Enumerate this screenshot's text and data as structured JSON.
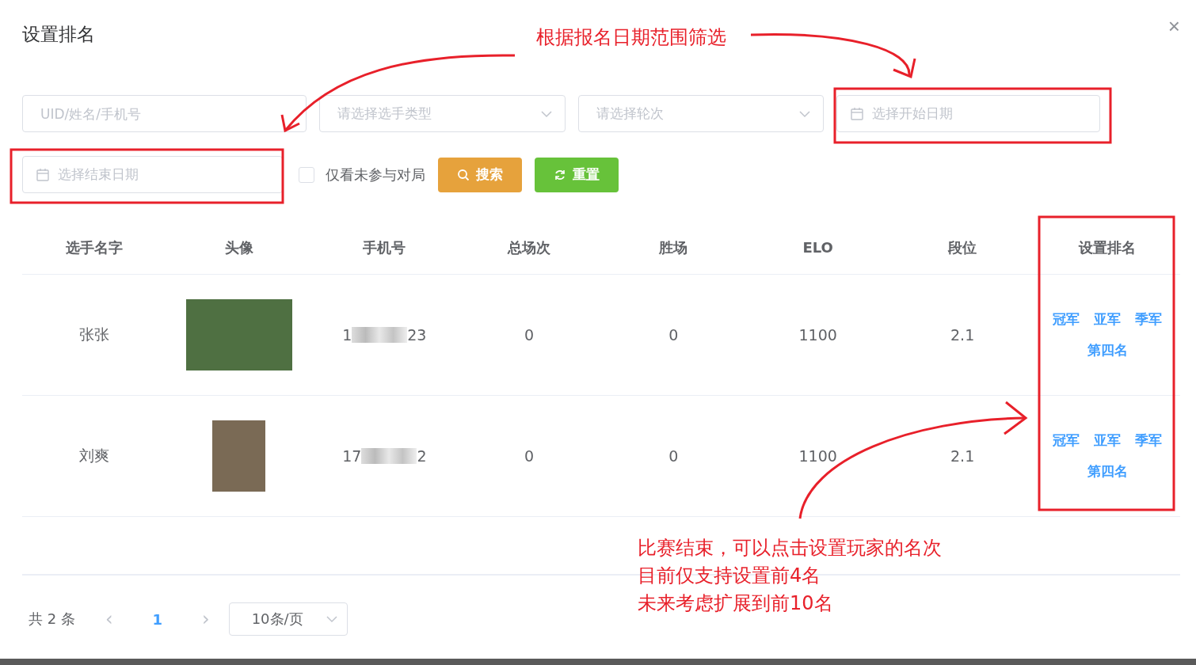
{
  "dialog": {
    "title": "设置排名",
    "close": "×"
  },
  "filters": [
    {
      "kind": "input",
      "placeholder": "UID/姓名/手机号"
    },
    {
      "kind": "select",
      "placeholder": "请选择选手类型"
    },
    {
      "kind": "select",
      "placeholder": "请选择轮次"
    },
    {
      "kind": "date",
      "placeholder": "选择开始日期"
    },
    {
      "kind": "date",
      "placeholder": "选择结束日期"
    }
  ],
  "only_unplayed": {
    "label": "仅看未参与对局",
    "checked": false
  },
  "buttons": [
    {
      "kind": "search",
      "label": "搜索"
    },
    {
      "kind": "reset",
      "label": "重置"
    }
  ],
  "table": {
    "columns": [
      "选手名字",
      "头像",
      "手机号",
      "总场次",
      "胜场",
      "ELO",
      "段位",
      "设置排名"
    ],
    "rows": [
      {
        "name": "张张",
        "avatar": {
          "kind": "landscape"
        },
        "phone_start": "1",
        "phone_end": "23",
        "total": "0",
        "wins": "0",
        "elo": "1100",
        "rank_level": "2.1",
        "actions": [
          "冠军",
          "亚军",
          "季军",
          "第四名"
        ]
      },
      {
        "name": "刘爽",
        "avatar": {
          "kind": "portrait"
        },
        "phone_start": "17",
        "phone_end": "2",
        "total": "0",
        "wins": "0",
        "elo": "1100",
        "rank_level": "2.1",
        "actions": [
          "冠军",
          "亚军",
          "季军",
          "第四名"
        ]
      }
    ]
  },
  "pagination": {
    "total": "共 2 条",
    "prev": "‹",
    "pages": [
      {
        "label": "1",
        "selected": true
      }
    ],
    "next": "›",
    "page_size": "10条/页"
  },
  "annotations": [
    {
      "kind": "note",
      "lines": [
        "根据报名日期范围筛选"
      ]
    },
    {
      "kind": "note",
      "lines": [
        "比赛结束，可以点击设置玩家的名次",
        "目前仅支持设置前4名",
        "未来考虑扩展到前10名"
      ]
    }
  ]
}
